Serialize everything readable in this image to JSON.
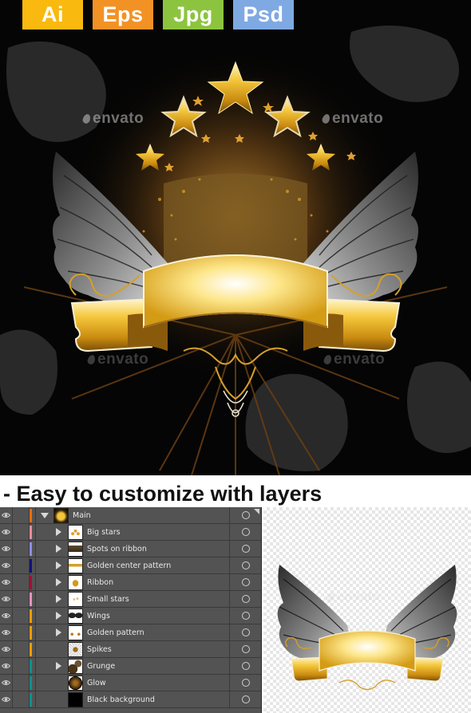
{
  "format_badges": [
    {
      "label": "Ai",
      "color": "#f9b90f"
    },
    {
      "label": "Eps",
      "color": "#f39224"
    },
    {
      "label": "Jpg",
      "color": "#8cc43f"
    },
    {
      "label": "Psd",
      "color": "#7fa9e3"
    }
  ],
  "watermark": "envato",
  "headline": "- Easy to customize with layers",
  "layers_panel": {
    "layers": [
      {
        "name": "Main",
        "color": "#ff6a00",
        "expanded": true,
        "has_children": true,
        "thumb": "main"
      },
      {
        "name": "Big stars",
        "color": "#f08a9a",
        "expanded": false,
        "has_children": true,
        "thumb": "stars"
      },
      {
        "name": "Spots on ribbon",
        "color": "#8c8cf0",
        "expanded": false,
        "has_children": true,
        "thumb": "spots"
      },
      {
        "name": "Golden center pattern",
        "color": "#101080",
        "expanded": false,
        "has_children": true,
        "thumb": "pattern"
      },
      {
        "name": "Ribbon",
        "color": "#a0103a",
        "expanded": false,
        "has_children": true,
        "thumb": "ribbon"
      },
      {
        "name": "Small stars",
        "color": "#f090c0",
        "expanded": false,
        "has_children": true,
        "thumb": "smallstars"
      },
      {
        "name": "Wings",
        "color": "#ff9a00",
        "expanded": false,
        "has_children": true,
        "thumb": "wings"
      },
      {
        "name": "Golden pattern",
        "color": "#ff9a00",
        "expanded": false,
        "has_children": true,
        "thumb": "gpattern"
      },
      {
        "name": "Spikes",
        "color": "#ff9a00",
        "expanded": false,
        "has_children": false,
        "thumb": "spikes"
      },
      {
        "name": "Grunge",
        "color": "#109090",
        "expanded": false,
        "has_children": true,
        "thumb": "grunge"
      },
      {
        "name": "Glow",
        "color": "#109090",
        "expanded": false,
        "has_children": false,
        "thumb": "glow"
      },
      {
        "name": "Black background",
        "color": "#109090",
        "expanded": false,
        "has_children": false,
        "thumb": "black"
      }
    ]
  }
}
